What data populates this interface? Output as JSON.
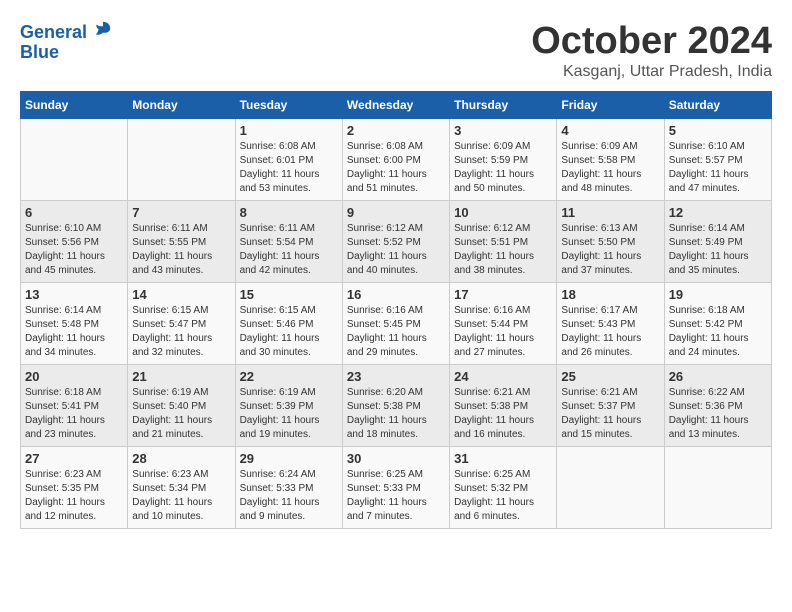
{
  "header": {
    "logo_line1": "General",
    "logo_line2": "Blue",
    "month_title": "October 2024",
    "location": "Kasganj, Uttar Pradesh, India"
  },
  "days_of_week": [
    "Sunday",
    "Monday",
    "Tuesday",
    "Wednesday",
    "Thursday",
    "Friday",
    "Saturday"
  ],
  "weeks": [
    [
      {
        "day": "",
        "info": ""
      },
      {
        "day": "",
        "info": ""
      },
      {
        "day": "1",
        "info": "Sunrise: 6:08 AM\nSunset: 6:01 PM\nDaylight: 11 hours and 53 minutes."
      },
      {
        "day": "2",
        "info": "Sunrise: 6:08 AM\nSunset: 6:00 PM\nDaylight: 11 hours and 51 minutes."
      },
      {
        "day": "3",
        "info": "Sunrise: 6:09 AM\nSunset: 5:59 PM\nDaylight: 11 hours and 50 minutes."
      },
      {
        "day": "4",
        "info": "Sunrise: 6:09 AM\nSunset: 5:58 PM\nDaylight: 11 hours and 48 minutes."
      },
      {
        "day": "5",
        "info": "Sunrise: 6:10 AM\nSunset: 5:57 PM\nDaylight: 11 hours and 47 minutes."
      }
    ],
    [
      {
        "day": "6",
        "info": "Sunrise: 6:10 AM\nSunset: 5:56 PM\nDaylight: 11 hours and 45 minutes."
      },
      {
        "day": "7",
        "info": "Sunrise: 6:11 AM\nSunset: 5:55 PM\nDaylight: 11 hours and 43 minutes."
      },
      {
        "day": "8",
        "info": "Sunrise: 6:11 AM\nSunset: 5:54 PM\nDaylight: 11 hours and 42 minutes."
      },
      {
        "day": "9",
        "info": "Sunrise: 6:12 AM\nSunset: 5:52 PM\nDaylight: 11 hours and 40 minutes."
      },
      {
        "day": "10",
        "info": "Sunrise: 6:12 AM\nSunset: 5:51 PM\nDaylight: 11 hours and 38 minutes."
      },
      {
        "day": "11",
        "info": "Sunrise: 6:13 AM\nSunset: 5:50 PM\nDaylight: 11 hours and 37 minutes."
      },
      {
        "day": "12",
        "info": "Sunrise: 6:14 AM\nSunset: 5:49 PM\nDaylight: 11 hours and 35 minutes."
      }
    ],
    [
      {
        "day": "13",
        "info": "Sunrise: 6:14 AM\nSunset: 5:48 PM\nDaylight: 11 hours and 34 minutes."
      },
      {
        "day": "14",
        "info": "Sunrise: 6:15 AM\nSunset: 5:47 PM\nDaylight: 11 hours and 32 minutes."
      },
      {
        "day": "15",
        "info": "Sunrise: 6:15 AM\nSunset: 5:46 PM\nDaylight: 11 hours and 30 minutes."
      },
      {
        "day": "16",
        "info": "Sunrise: 6:16 AM\nSunset: 5:45 PM\nDaylight: 11 hours and 29 minutes."
      },
      {
        "day": "17",
        "info": "Sunrise: 6:16 AM\nSunset: 5:44 PM\nDaylight: 11 hours and 27 minutes."
      },
      {
        "day": "18",
        "info": "Sunrise: 6:17 AM\nSunset: 5:43 PM\nDaylight: 11 hours and 26 minutes."
      },
      {
        "day": "19",
        "info": "Sunrise: 6:18 AM\nSunset: 5:42 PM\nDaylight: 11 hours and 24 minutes."
      }
    ],
    [
      {
        "day": "20",
        "info": "Sunrise: 6:18 AM\nSunset: 5:41 PM\nDaylight: 11 hours and 23 minutes."
      },
      {
        "day": "21",
        "info": "Sunrise: 6:19 AM\nSunset: 5:40 PM\nDaylight: 11 hours and 21 minutes."
      },
      {
        "day": "22",
        "info": "Sunrise: 6:19 AM\nSunset: 5:39 PM\nDaylight: 11 hours and 19 minutes."
      },
      {
        "day": "23",
        "info": "Sunrise: 6:20 AM\nSunset: 5:38 PM\nDaylight: 11 hours and 18 minutes."
      },
      {
        "day": "24",
        "info": "Sunrise: 6:21 AM\nSunset: 5:38 PM\nDaylight: 11 hours and 16 minutes."
      },
      {
        "day": "25",
        "info": "Sunrise: 6:21 AM\nSunset: 5:37 PM\nDaylight: 11 hours and 15 minutes."
      },
      {
        "day": "26",
        "info": "Sunrise: 6:22 AM\nSunset: 5:36 PM\nDaylight: 11 hours and 13 minutes."
      }
    ],
    [
      {
        "day": "27",
        "info": "Sunrise: 6:23 AM\nSunset: 5:35 PM\nDaylight: 11 hours and 12 minutes."
      },
      {
        "day": "28",
        "info": "Sunrise: 6:23 AM\nSunset: 5:34 PM\nDaylight: 11 hours and 10 minutes."
      },
      {
        "day": "29",
        "info": "Sunrise: 6:24 AM\nSunset: 5:33 PM\nDaylight: 11 hours and 9 minutes."
      },
      {
        "day": "30",
        "info": "Sunrise: 6:25 AM\nSunset: 5:33 PM\nDaylight: 11 hours and 7 minutes."
      },
      {
        "day": "31",
        "info": "Sunrise: 6:25 AM\nSunset: 5:32 PM\nDaylight: 11 hours and 6 minutes."
      },
      {
        "day": "",
        "info": ""
      },
      {
        "day": "",
        "info": ""
      }
    ]
  ]
}
